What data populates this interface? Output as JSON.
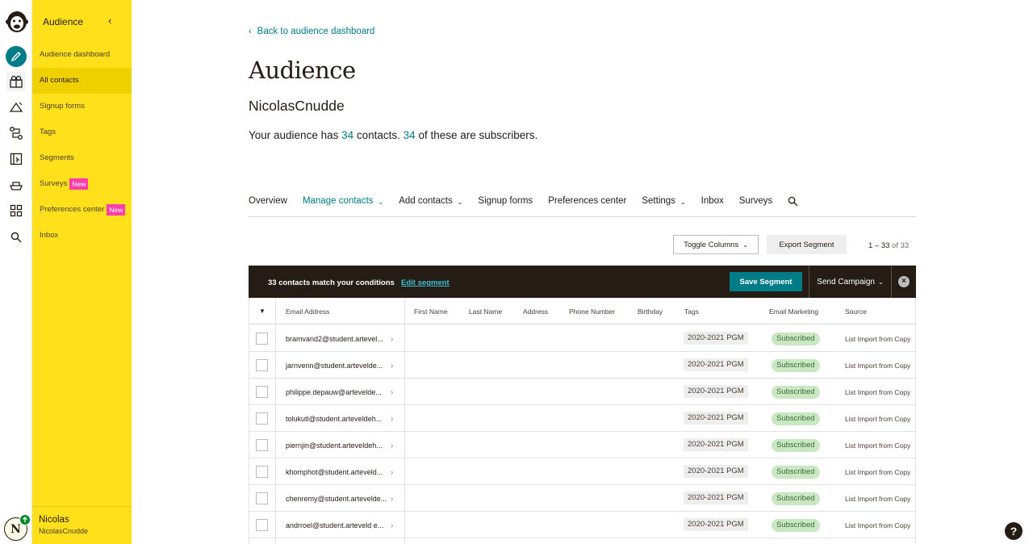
{
  "sidebar": {
    "title": "Audience",
    "collapse_icon": "chevron-left-icon",
    "items": [
      {
        "label": "Audience dashboard",
        "badge": ""
      },
      {
        "label": "All contacts",
        "badge": ""
      },
      {
        "label": "Signup forms",
        "badge": ""
      },
      {
        "label": "Tags",
        "badge": ""
      },
      {
        "label": "Segments",
        "badge": ""
      },
      {
        "label": "Surveys",
        "badge": "New"
      },
      {
        "label": "Preferences center",
        "badge": "New"
      },
      {
        "label": "Inbox",
        "badge": ""
      }
    ],
    "user": {
      "name": "Nicolas",
      "username": "NicolasCnudde",
      "initial": "N"
    }
  },
  "main": {
    "back_link": "Back to audience dashboard",
    "title": "Audience",
    "audience_name": "NicolasCnudde",
    "summary": {
      "prefix": "Your audience has ",
      "contacts": "34",
      "middle": " contacts. ",
      "subscribers": "34",
      "suffix": " of these are subscribers."
    },
    "tabs": [
      {
        "label": "Overview",
        "dropdown": false
      },
      {
        "label": "Manage contacts",
        "dropdown": true
      },
      {
        "label": "Add contacts",
        "dropdown": true
      },
      {
        "label": "Signup forms",
        "dropdown": false
      },
      {
        "label": "Preferences center",
        "dropdown": false
      },
      {
        "label": "Settings",
        "dropdown": true
      },
      {
        "label": "Inbox",
        "dropdown": false
      },
      {
        "label": "Surveys",
        "dropdown": false
      }
    ],
    "toolbar": {
      "toggle_columns": "Toggle Columns",
      "export_segment": "Export Segment",
      "pager_range": "1 – 33",
      "pager_of": " of 33"
    },
    "segment_bar": {
      "match_text": "33 contacts match your conditions",
      "edit_link": "Edit segment",
      "save_button": "Save Segment",
      "send_button": "Send Campaign"
    },
    "table": {
      "headers": [
        "Email Address",
        "First Name",
        "Last Name",
        "Address",
        "Phone Number",
        "Birthday",
        "Tags",
        "Email Marketing",
        "Source"
      ],
      "rows": [
        {
          "email": "bramvand2@student.artevel...",
          "tag": "2020-2021 PGM",
          "status": "Subscribed",
          "source": "List Import from Copy"
        },
        {
          "email": "jarnvenn@student.artevelde...",
          "tag": "2020-2021 PGM",
          "status": "Subscribed",
          "source": "List Import from Copy"
        },
        {
          "email": "philippe.depauw@artevelde...",
          "tag": "2020-2021 PGM",
          "status": "Subscribed",
          "source": "List Import from Copy"
        },
        {
          "email": "tolukutl@student.arteveldeh...",
          "tag": "2020-2021 PGM",
          "status": "Subscribed",
          "source": "List Import from Copy"
        },
        {
          "email": "piernjin@student.arteveldeh...",
          "tag": "2020-2021 PGM",
          "status": "Subscribed",
          "source": "List Import from Copy"
        },
        {
          "email": "khomphot@student.arteveld...",
          "tag": "2020-2021 PGM",
          "status": "Subscribed",
          "source": "List Import from Copy"
        },
        {
          "email": "chenremy@student.artevelde...",
          "tag": "2020-2021 PGM",
          "status": "Subscribed",
          "source": "List Import from Copy"
        },
        {
          "email": "andrroel@student.arteveld e...",
          "tag": "2020-2021 PGM",
          "status": "Subscribed",
          "source": "List Import from Copy"
        }
      ]
    }
  },
  "help_label": "?",
  "colors": {
    "accent": "#007c89",
    "panel": "#ffe01b",
    "new_badge": "#ff3cac",
    "dark": "#241c15",
    "subscribed_bg": "#c8e7c2"
  }
}
